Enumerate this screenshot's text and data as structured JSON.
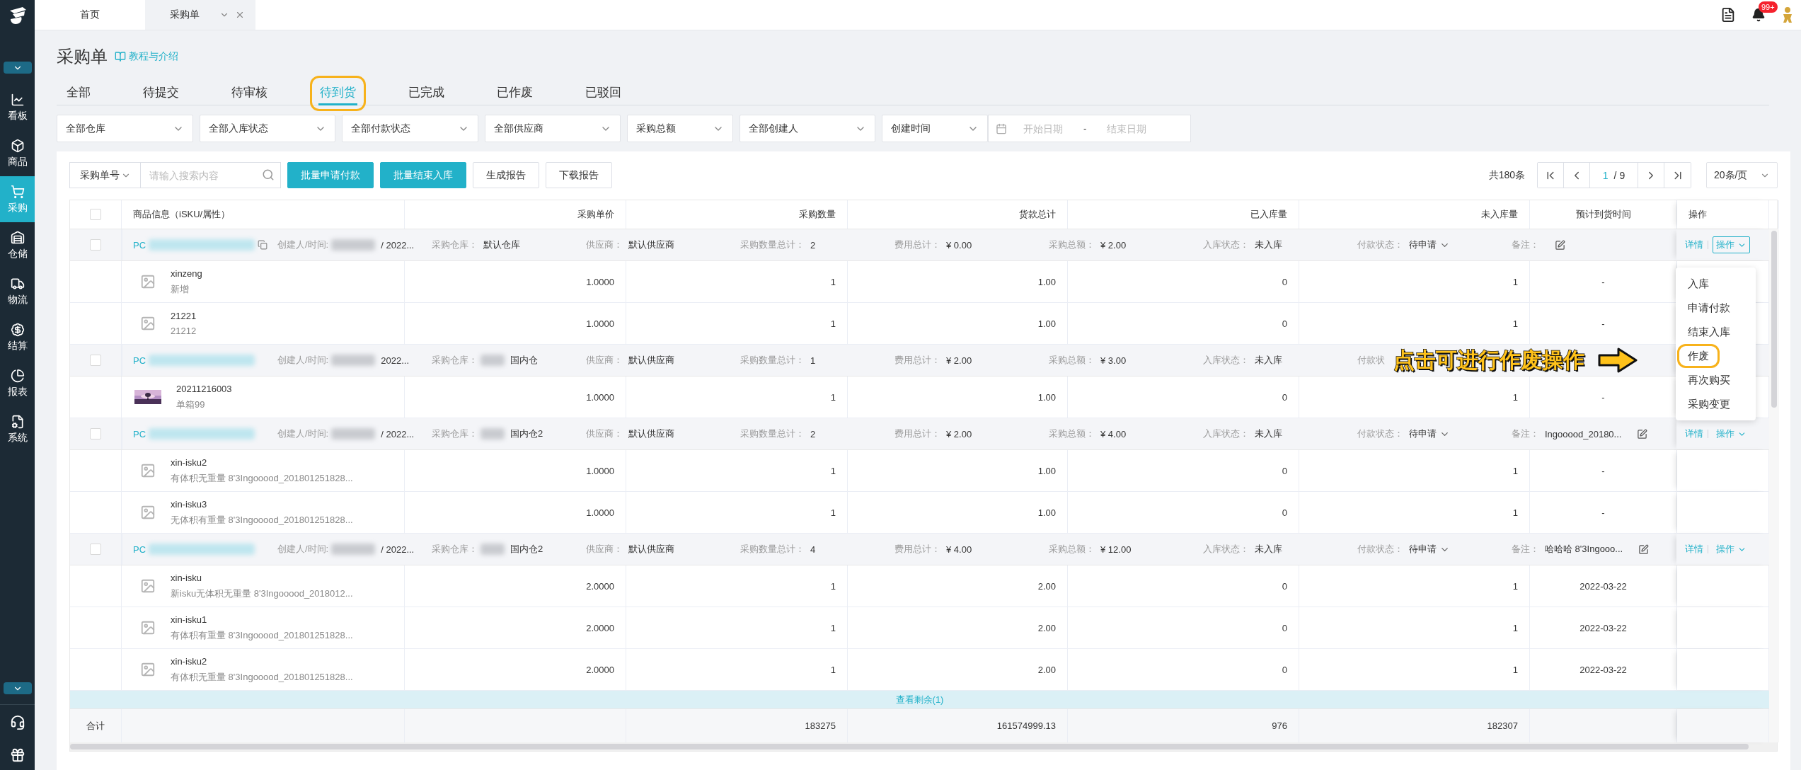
{
  "sidebar": {
    "items": [
      {
        "label": "看板",
        "selected": false
      },
      {
        "label": "商品",
        "selected": false
      },
      {
        "label": "采购",
        "selected": true
      },
      {
        "label": "仓储",
        "selected": false
      },
      {
        "label": "物流",
        "selected": false
      },
      {
        "label": "结算",
        "selected": false
      },
      {
        "label": "报表",
        "selected": false
      },
      {
        "label": "系统",
        "selected": false
      }
    ]
  },
  "tab_bar": {
    "tabs": [
      {
        "label": "首页",
        "selected": false
      },
      {
        "label": "采购单",
        "selected": true,
        "closable": true
      }
    ],
    "notification_badge": "99+"
  },
  "page": {
    "title": "采购单",
    "help_link": "教程与介绍"
  },
  "status_tabs": [
    {
      "label": "全部",
      "selected": false,
      "highlighted": false
    },
    {
      "label": "待提交",
      "selected": false,
      "highlighted": false
    },
    {
      "label": "待审核",
      "selected": false,
      "highlighted": false
    },
    {
      "label": "待到货",
      "selected": true,
      "highlighted": true
    },
    {
      "label": "已完成",
      "selected": false,
      "highlighted": false
    },
    {
      "label": "已作废",
      "selected": false,
      "highlighted": false
    },
    {
      "label": "已驳回",
      "selected": false,
      "highlighted": false
    }
  ],
  "filters": [
    {
      "kind": "select",
      "value": "全部仓库"
    },
    {
      "kind": "select",
      "value": "全部入库状态"
    },
    {
      "kind": "select",
      "value": "全部付款状态"
    },
    {
      "kind": "select",
      "value": "全部供应商"
    },
    {
      "kind": "select",
      "value": "采购总额"
    },
    {
      "kind": "select",
      "value": "全部创建人"
    },
    {
      "kind": "select",
      "value": "创建时间"
    },
    {
      "kind": "date_range",
      "start_placeholder": "开始日期",
      "separator": "-",
      "end_placeholder": "结束日期"
    }
  ],
  "toolbar": {
    "search_type": "采购单号",
    "search_placeholder": "请输入搜索内容",
    "buttons": [
      {
        "label": "批量申请付款",
        "primary": true
      },
      {
        "label": "批量结束入库",
        "primary": true
      },
      {
        "label": "生成报告",
        "primary": false
      },
      {
        "label": "下载报告",
        "primary": false
      }
    ],
    "total": "共180条",
    "pager": {
      "current": "1",
      "pages": "/ 9"
    },
    "page_size": "20条/页"
  },
  "table": {
    "header_checked": false,
    "columns": [
      "商品信息（iSKU/属性）",
      "采购单价",
      "采购数量",
      "货款总计",
      "已入库量",
      "未入库量",
      "预计到货时间",
      "操作"
    ],
    "groups": [
      {
        "checked": false,
        "order": {
          "prefix": "PC",
          "copyable": true
        },
        "fields": [
          {
            "kind": "text",
            "label": "创建人/时间:",
            "value": "/ 2022...",
            "masked": true
          },
          {
            "kind": "text",
            "label": "采购仓库：",
            "value": "默认仓库"
          },
          {
            "kind": "text",
            "label": "供应商：",
            "value": "默认供应商"
          },
          {
            "kind": "text",
            "label": "采购数量总计：",
            "value": "2"
          },
          {
            "kind": "text",
            "label": "费用总计：",
            "value": "¥ 0.00"
          },
          {
            "kind": "text",
            "label": "采购总额：",
            "value": "¥ 2.00"
          },
          {
            "kind": "text",
            "label": "入库状态：",
            "value": "未入库"
          },
          {
            "kind": "dropdown",
            "label": "付款状态：",
            "value": "待申请"
          },
          {
            "kind": "remark",
            "label": "备注："
          }
        ],
        "actions": {
          "detail": "详情",
          "operate": "操作",
          "open": true
        },
        "items": [
          {
            "kind": "placeholder",
            "name": "xinzeng",
            "attrs": "新增",
            "price": "1.0000",
            "qty": "1",
            "amount": "1.00",
            "received": "0",
            "pending": "1",
            "eta": "-"
          },
          {
            "kind": "placeholder",
            "name": "21221",
            "attrs": "21212",
            "price": "1.0000",
            "qty": "1",
            "amount": "1.00",
            "received": "0",
            "pending": "1",
            "eta": "-"
          }
        ]
      },
      {
        "checked": false,
        "order": {
          "prefix": "PC"
        },
        "fields": [
          {
            "kind": "text",
            "label": "创建人/时间:",
            "value": "2022...",
            "masked": true
          },
          {
            "kind": "text",
            "label": "采购仓库：",
            "value": "国内仓",
            "masked": true
          },
          {
            "kind": "text",
            "label": "供应商：",
            "value": "默认供应商"
          },
          {
            "kind": "text",
            "label": "采购数量总计：",
            "value": "1"
          },
          {
            "kind": "text",
            "label": "费用总计：",
            "value": "¥ 2.00"
          },
          {
            "kind": "text",
            "label": "采购总额：",
            "value": "¥ 3.00"
          },
          {
            "kind": "text",
            "label": "入库状态：",
            "value": "未入库"
          },
          {
            "kind": "covered",
            "label": "付款状"
          }
        ],
        "items": [
          {
            "kind": "picture",
            "name": "20211216003",
            "attrs": "单箱99",
            "price": "1.0000",
            "qty": "1",
            "amount": "1.00",
            "received": "0",
            "pending": "1",
            "eta": "-"
          }
        ]
      },
      {
        "checked": false,
        "order": {
          "prefix": "PC"
        },
        "fields": [
          {
            "kind": "text",
            "label": "创建人/时间:",
            "value": "/ 2022...",
            "masked": true
          },
          {
            "kind": "text",
            "label": "采购仓库：",
            "value": "国内仓2",
            "masked": true
          },
          {
            "kind": "text",
            "label": "供应商：",
            "value": "默认供应商"
          },
          {
            "kind": "text",
            "label": "采购数量总计：",
            "value": "2"
          },
          {
            "kind": "text",
            "label": "费用总计：",
            "value": "¥ 2.00"
          },
          {
            "kind": "text",
            "label": "采购总额：",
            "value": "¥ 4.00"
          },
          {
            "kind": "text",
            "label": "入库状态：",
            "value": "未入库"
          },
          {
            "kind": "dropdown",
            "label": "付款状态：",
            "value": "待申请"
          },
          {
            "kind": "remark",
            "label": "备注：",
            "value": "Ingooood_20180..."
          }
        ],
        "actions": {
          "detail": "详情",
          "operate": "操作",
          "open": false
        },
        "items": [
          {
            "kind": "placeholder",
            "name": "xin-isku2",
            "attrs": "有体积无重量 8'3Ingooood_201801251828...",
            "price": "1.0000",
            "qty": "1",
            "amount": "1.00",
            "received": "0",
            "pending": "1",
            "eta": "-"
          },
          {
            "kind": "placeholder",
            "name": "xin-isku3",
            "attrs": "无体积有重量 8'3Ingooood_201801251828...",
            "price": "1.0000",
            "qty": "1",
            "amount": "1.00",
            "received": "0",
            "pending": "1",
            "eta": "-"
          }
        ]
      },
      {
        "checked": false,
        "order": {
          "prefix": "PC"
        },
        "fields": [
          {
            "kind": "text",
            "label": "创建人/时间:",
            "value": "/ 2022...",
            "masked": true
          },
          {
            "kind": "text",
            "label": "采购仓库：",
            "value": "国内仓2",
            "masked": true
          },
          {
            "kind": "text",
            "label": "供应商：",
            "value": "默认供应商"
          },
          {
            "kind": "text",
            "label": "采购数量总计：",
            "value": "4"
          },
          {
            "kind": "text",
            "label": "费用总计：",
            "value": "¥ 4.00"
          },
          {
            "kind": "text",
            "label": "采购总额：",
            "value": "¥ 12.00"
          },
          {
            "kind": "text",
            "label": "入库状态：",
            "value": "未入库"
          },
          {
            "kind": "dropdown",
            "label": "付款状态：",
            "value": "待申请"
          },
          {
            "kind": "remark",
            "label": "备注：",
            "value": "哈哈哈 8'3Ingooo..."
          }
        ],
        "actions": {
          "detail": "详情",
          "operate": "操作",
          "open": false
        },
        "items": [
          {
            "kind": "placeholder",
            "name": "xin-isku",
            "attrs": "新isku无体积无重量 8'3Ingooood_2018012...",
            "price": "2.0000",
            "qty": "1",
            "amount": "2.00",
            "received": "0",
            "pending": "1",
            "eta": "2022-03-22"
          },
          {
            "kind": "placeholder",
            "name": "xin-isku1",
            "attrs": "有体积有重量 8'3Ingooood_201801251828...",
            "price": "2.0000",
            "qty": "1",
            "amount": "2.00",
            "received": "0",
            "pending": "1",
            "eta": "2022-03-22"
          },
          {
            "kind": "placeholder",
            "name": "xin-isku2",
            "attrs": "有体积无重量 8'3Ingooood_201801251828...",
            "price": "2.0000",
            "qty": "1",
            "amount": "2.00",
            "received": "0",
            "pending": "1",
            "eta": "2022-03-22"
          }
        ]
      }
    ],
    "show_more": "查看剩余(1)",
    "summary": {
      "label": "合计",
      "qty": "183275",
      "amount": "161574999.13",
      "received": "976",
      "pending": "182307"
    }
  },
  "action_menu": {
    "items": [
      {
        "label": "入库",
        "highlighted": false
      },
      {
        "label": "申请付款",
        "highlighted": false
      },
      {
        "label": "结束入库",
        "highlighted": false
      },
      {
        "label": "作废",
        "highlighted": true
      },
      {
        "label": "再次购买",
        "highlighted": false
      },
      {
        "label": "采购变更",
        "highlighted": false
      }
    ]
  },
  "annotation": {
    "text": "点击可进行作废操作"
  }
}
